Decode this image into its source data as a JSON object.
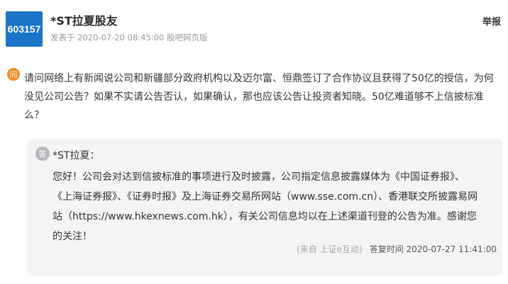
{
  "header": {
    "avatar_text": "603157",
    "user_name": "*ST拉夏股友",
    "post_meta": "发表于 2020-07-20 08:45:00 股吧网页版",
    "report_label": "举报",
    "avatar_color": "#1c74c8"
  },
  "question": {
    "badge": "问",
    "badge_color": "#f08c2c",
    "text": "请问网络上有新闻说公司和新疆部分政府机构以及迈尔富、恒鼎签订了合作协议且获得了50亿的授信，为何没见公司公告？如果不实请公告否认，如果确认，那也应该公告让投资者知晓。50亿难道够不上信披标准么？"
  },
  "answer": {
    "badge": "答",
    "badge_color": "#b5b8bd",
    "answerer": "*ST拉夏：",
    "text": "您好！公司会对达到信披标准的事项进行及时披露，公司指定信息披露媒体为《中国证券报》、《上海证券报》、《证券时报》及上海证券交易所网站（www.sse.com.cn）、香港联交所披露易网站（https://www.hkexnews.com.hk），有关公司信息均以在上述渠道刊登的公告为准。感谢您的关注！",
    "source": "(来自 上证e互动)",
    "time": "答复时间 2020-07-27 11:41:00"
  }
}
